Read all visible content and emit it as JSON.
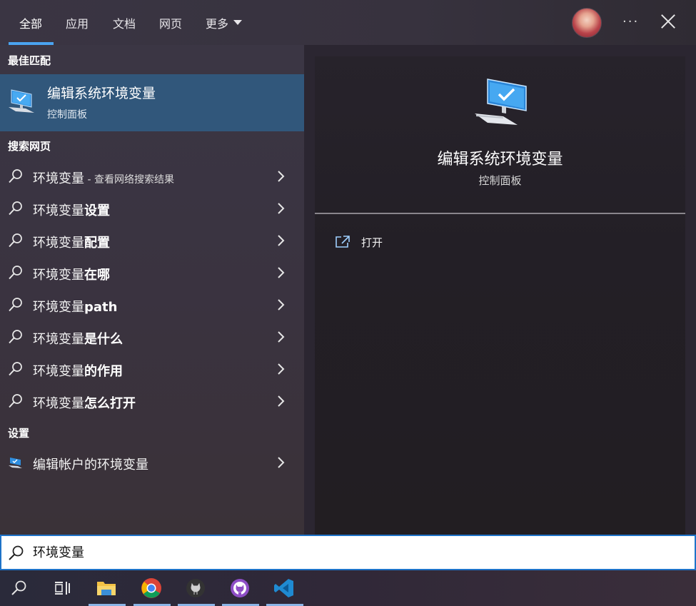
{
  "tabs": [
    {
      "label": "全部"
    },
    {
      "label": "应用"
    },
    {
      "label": "文档"
    },
    {
      "label": "网页"
    },
    {
      "label": "更多"
    }
  ],
  "header": {
    "more_dots": "···"
  },
  "sections": {
    "best_match": "最佳匹配",
    "search_web": "搜索网页",
    "settings": "设置"
  },
  "best_match": {
    "title": "编辑系统环境变量",
    "subtitle": "控制面板"
  },
  "web_results": [
    {
      "query": "环境变量",
      "bold": "",
      "hint": " - 查看网络搜索结果"
    },
    {
      "query": "环境变量",
      "bold": "设置",
      "hint": ""
    },
    {
      "query": "环境变量",
      "bold": "配置",
      "hint": ""
    },
    {
      "query": "环境变量",
      "bold": "在哪",
      "hint": ""
    },
    {
      "query": "环境变量",
      "bold": "path",
      "hint": ""
    },
    {
      "query": "环境变量",
      "bold": "是什么",
      "hint": ""
    },
    {
      "query": "环境变量",
      "bold": "的作用",
      "hint": ""
    },
    {
      "query": "环境变量",
      "bold": "怎么打开",
      "hint": ""
    }
  ],
  "settings_results": [
    {
      "label": "编辑帐户的环境变量"
    }
  ],
  "detail": {
    "title": "编辑系统环境变量",
    "subtitle": "控制面板",
    "actions": [
      {
        "label": "打开"
      }
    ]
  },
  "search": {
    "value": "环境变量"
  },
  "taskbar": {
    "items": [
      "search-icon",
      "task-view-icon",
      "file-explorer-icon",
      "chrome-icon",
      "github-desktop-icon",
      "github-icon",
      "vscode-icon"
    ]
  },
  "colors": {
    "accent": "#4aa3f0",
    "selected_row": "#31577b",
    "search_border": "#1e73c8"
  }
}
